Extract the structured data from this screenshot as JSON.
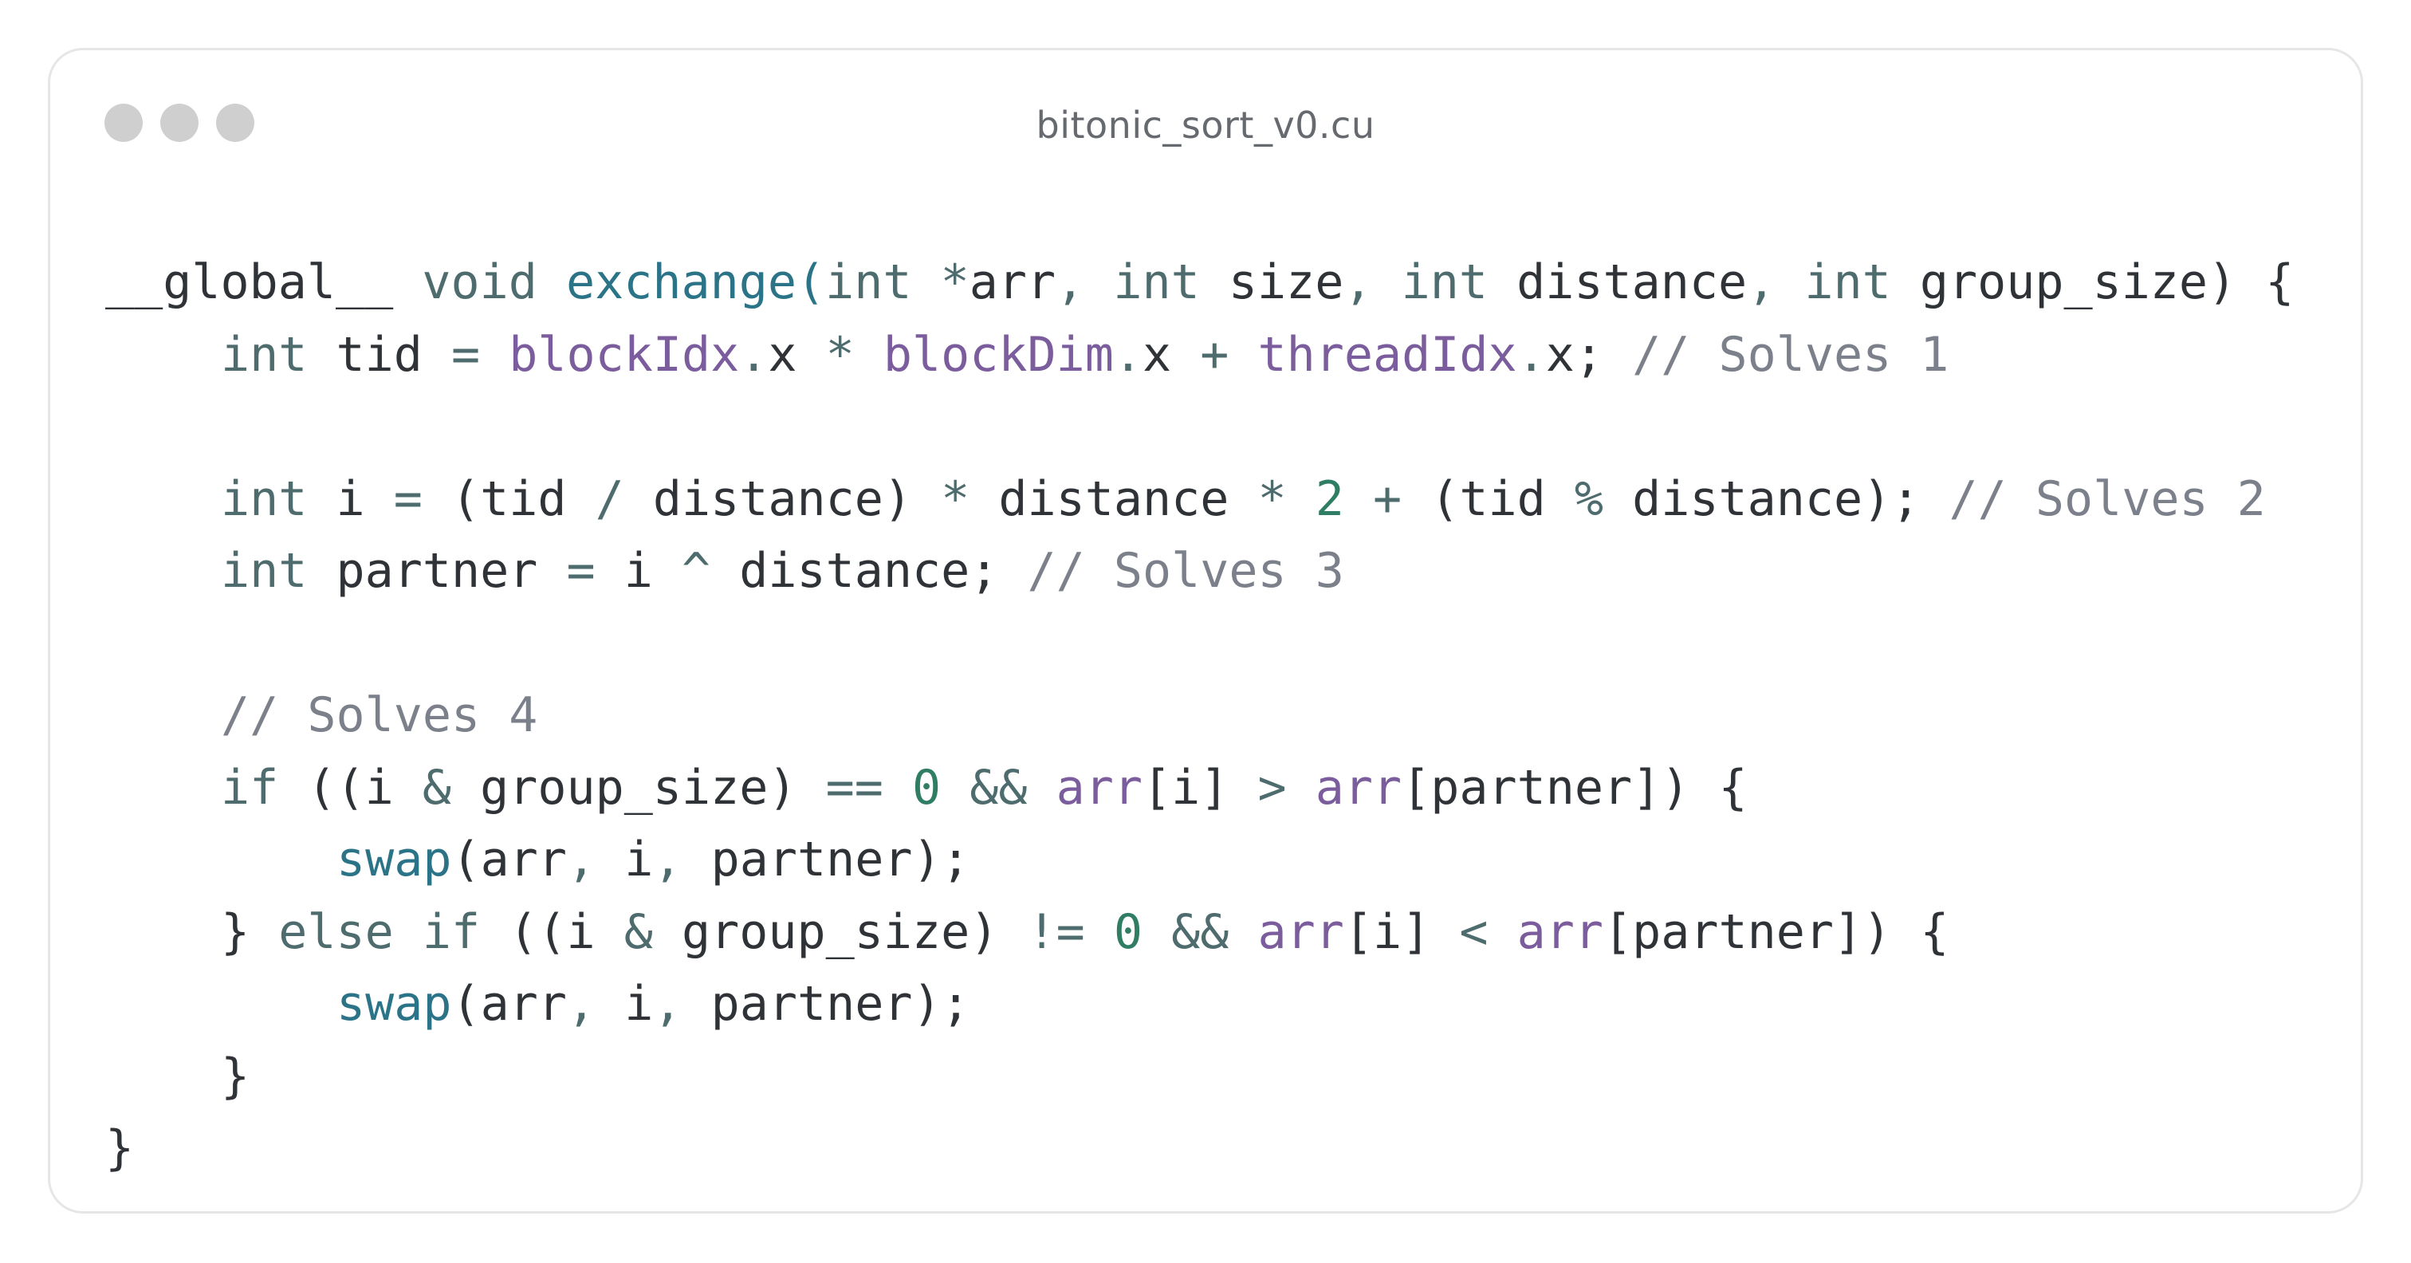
{
  "window": {
    "title": "bitonic_sort_v0.cu",
    "controls": [
      "close-dot",
      "minimize-dot",
      "maximize-dot"
    ]
  },
  "colors": {
    "background": "#ffffff",
    "border": "#e6e6e6",
    "window_dots": "#cfcfcf",
    "text": "#2f3236",
    "keyword": "#4e6b6d",
    "function": "#2b7387",
    "builtin": "#7b5c9c",
    "number": "#2f7d64",
    "comment": "#7b808a"
  },
  "code": {
    "lines": [
      {
        "indent": 0,
        "tokens": [
          {
            "t": "__global__",
            "c": "pl"
          },
          {
            "t": " ",
            "c": "pl"
          },
          {
            "t": "void",
            "c": "kw"
          },
          {
            "t": " ",
            "c": "pl"
          },
          {
            "t": "exchange",
            "c": "fn"
          },
          {
            "t": "(",
            "c": "fn"
          },
          {
            "t": "int",
            "c": "kw"
          },
          {
            "t": " ",
            "c": "pl"
          },
          {
            "t": "*",
            "c": "op"
          },
          {
            "t": "arr",
            "c": "pl"
          },
          {
            "t": ",",
            "c": "op"
          },
          {
            "t": " ",
            "c": "pl"
          },
          {
            "t": "int",
            "c": "kw"
          },
          {
            "t": " size",
            "c": "pl"
          },
          {
            "t": ",",
            "c": "op"
          },
          {
            "t": " ",
            "c": "pl"
          },
          {
            "t": "int",
            "c": "kw"
          },
          {
            "t": " distance",
            "c": "pl"
          },
          {
            "t": ",",
            "c": "op"
          },
          {
            "t": " ",
            "c": "pl"
          },
          {
            "t": "int",
            "c": "kw"
          },
          {
            "t": " group_size) {",
            "c": "pl"
          }
        ]
      },
      {
        "indent": 1,
        "tokens": [
          {
            "t": "int",
            "c": "kw"
          },
          {
            "t": " tid ",
            "c": "pl"
          },
          {
            "t": "=",
            "c": "op"
          },
          {
            "t": " ",
            "c": "pl"
          },
          {
            "t": "blockIdx",
            "c": "bi"
          },
          {
            "t": ".",
            "c": "op"
          },
          {
            "t": "x ",
            "c": "pl"
          },
          {
            "t": "*",
            "c": "op"
          },
          {
            "t": " ",
            "c": "pl"
          },
          {
            "t": "blockDim",
            "c": "bi"
          },
          {
            "t": ".",
            "c": "op"
          },
          {
            "t": "x ",
            "c": "pl"
          },
          {
            "t": "+",
            "c": "op"
          },
          {
            "t": " ",
            "c": "pl"
          },
          {
            "t": "threadIdx",
            "c": "bi"
          },
          {
            "t": ".",
            "c": "op"
          },
          {
            "t": "x; ",
            "c": "pl"
          },
          {
            "t": "// Solves 1",
            "c": "cmt"
          }
        ]
      },
      {
        "indent": 0,
        "tokens": []
      },
      {
        "indent": 1,
        "tokens": [
          {
            "t": "int",
            "c": "kw"
          },
          {
            "t": " i ",
            "c": "pl"
          },
          {
            "t": "=",
            "c": "op"
          },
          {
            "t": " (tid ",
            "c": "pl"
          },
          {
            "t": "/",
            "c": "op"
          },
          {
            "t": " distance) ",
            "c": "pl"
          },
          {
            "t": "*",
            "c": "op"
          },
          {
            "t": " distance ",
            "c": "pl"
          },
          {
            "t": "*",
            "c": "op"
          },
          {
            "t": " ",
            "c": "pl"
          },
          {
            "t": "2",
            "c": "num"
          },
          {
            "t": " ",
            "c": "pl"
          },
          {
            "t": "+",
            "c": "op"
          },
          {
            "t": " (tid ",
            "c": "pl"
          },
          {
            "t": "%",
            "c": "op"
          },
          {
            "t": " distance); ",
            "c": "pl"
          },
          {
            "t": "// Solves 2",
            "c": "cmt"
          }
        ]
      },
      {
        "indent": 1,
        "tokens": [
          {
            "t": "int",
            "c": "kw"
          },
          {
            "t": " partner ",
            "c": "pl"
          },
          {
            "t": "=",
            "c": "op"
          },
          {
            "t": " i ",
            "c": "pl"
          },
          {
            "t": "^",
            "c": "op"
          },
          {
            "t": " distance; ",
            "c": "pl"
          },
          {
            "t": "// Solves 3",
            "c": "cmt"
          }
        ]
      },
      {
        "indent": 0,
        "tokens": []
      },
      {
        "indent": 1,
        "tokens": [
          {
            "t": "// Solves 4",
            "c": "cmt"
          }
        ]
      },
      {
        "indent": 1,
        "tokens": [
          {
            "t": "if",
            "c": "kw"
          },
          {
            "t": " ((i ",
            "c": "pl"
          },
          {
            "t": "&",
            "c": "op"
          },
          {
            "t": " group_size) ",
            "c": "pl"
          },
          {
            "t": "==",
            "c": "op"
          },
          {
            "t": " ",
            "c": "pl"
          },
          {
            "t": "0",
            "c": "num"
          },
          {
            "t": " ",
            "c": "pl"
          },
          {
            "t": "&&",
            "c": "op"
          },
          {
            "t": " ",
            "c": "pl"
          },
          {
            "t": "arr",
            "c": "bi"
          },
          {
            "t": "[i] ",
            "c": "pl"
          },
          {
            "t": ">",
            "c": "op"
          },
          {
            "t": " ",
            "c": "pl"
          },
          {
            "t": "arr",
            "c": "bi"
          },
          {
            "t": "[partner]) {",
            "c": "pl"
          }
        ]
      },
      {
        "indent": 2,
        "tokens": [
          {
            "t": "swap",
            "c": "fn"
          },
          {
            "t": "(arr",
            "c": "pl"
          },
          {
            "t": ",",
            "c": "op"
          },
          {
            "t": " i",
            "c": "pl"
          },
          {
            "t": ",",
            "c": "op"
          },
          {
            "t": " partner);",
            "c": "pl"
          }
        ]
      },
      {
        "indent": 1,
        "tokens": [
          {
            "t": "} ",
            "c": "pl"
          },
          {
            "t": "else",
            "c": "kw"
          },
          {
            "t": " ",
            "c": "pl"
          },
          {
            "t": "if",
            "c": "kw"
          },
          {
            "t": " ((i ",
            "c": "pl"
          },
          {
            "t": "&",
            "c": "op"
          },
          {
            "t": " group_size) ",
            "c": "pl"
          },
          {
            "t": "!=",
            "c": "op"
          },
          {
            "t": " ",
            "c": "pl"
          },
          {
            "t": "0",
            "c": "num"
          },
          {
            "t": " ",
            "c": "pl"
          },
          {
            "t": "&&",
            "c": "op"
          },
          {
            "t": " ",
            "c": "pl"
          },
          {
            "t": "arr",
            "c": "bi"
          },
          {
            "t": "[i] ",
            "c": "pl"
          },
          {
            "t": "<",
            "c": "op"
          },
          {
            "t": " ",
            "c": "pl"
          },
          {
            "t": "arr",
            "c": "bi"
          },
          {
            "t": "[partner]) {",
            "c": "pl"
          }
        ]
      },
      {
        "indent": 2,
        "tokens": [
          {
            "t": "swap",
            "c": "fn"
          },
          {
            "t": "(arr",
            "c": "pl"
          },
          {
            "t": ",",
            "c": "op"
          },
          {
            "t": " i",
            "c": "pl"
          },
          {
            "t": ",",
            "c": "op"
          },
          {
            "t": " partner);",
            "c": "pl"
          }
        ]
      },
      {
        "indent": 1,
        "tokens": [
          {
            "t": "}",
            "c": "pl"
          }
        ]
      },
      {
        "indent": 0,
        "tokens": [
          {
            "t": "}",
            "c": "pl"
          }
        ]
      }
    ]
  }
}
